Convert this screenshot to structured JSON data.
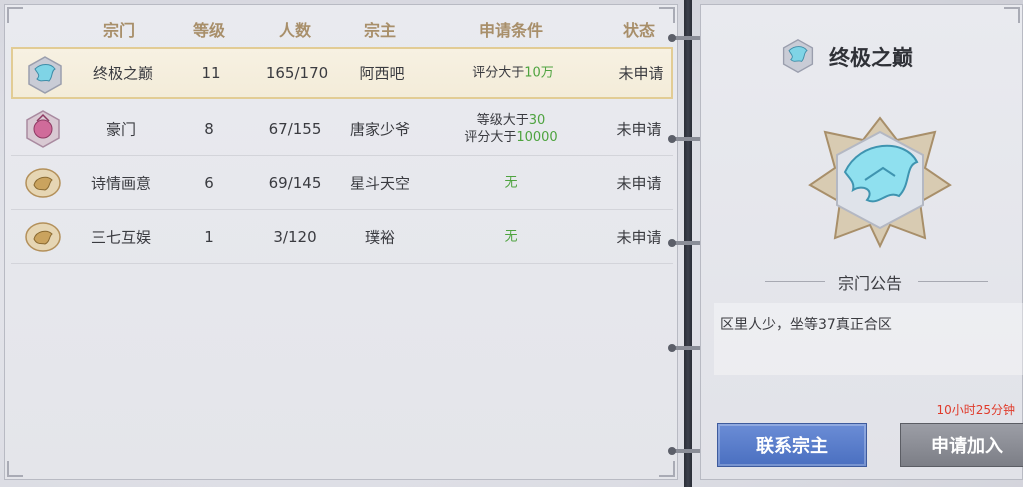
{
  "table": {
    "headers": {
      "sect": "宗门",
      "level": "等级",
      "members": "人数",
      "leader": "宗主",
      "conditions": "申请条件",
      "status": "状态"
    },
    "rows": [
      {
        "name": "终极之巅",
        "level": "11",
        "members": "165/170",
        "leader": "阿西吧",
        "cond_prefix": "评分大于",
        "cond_value": "10万",
        "status": "未申请",
        "emblem": "dragon-emblem-icon",
        "selected": true
      },
      {
        "name": "豪门",
        "level": "8",
        "members": "67/155",
        "leader": "唐家少爷",
        "cond_line1_prefix": "等级大于",
        "cond_line1_value": "30",
        "cond_line2_prefix": "评分大于",
        "cond_line2_value": "10000",
        "status": "未申请",
        "emblem": "pink-crest-emblem-icon"
      },
      {
        "name": "诗情画意",
        "level": "6",
        "members": "69/145",
        "leader": "星斗天空",
        "cond_none": "无",
        "status": "未申请",
        "emblem": "gold-beast-emblem-icon"
      },
      {
        "name": "三七互娱",
        "level": "1",
        "members": "3/120",
        "leader": "璞裕",
        "cond_none": "无",
        "status": "未申请",
        "emblem": "gold-beast-emblem-icon"
      }
    ]
  },
  "detail": {
    "title": "终极之巅",
    "notice_heading": "宗门公告",
    "notice_text": "区里人少，坐等37真正合区",
    "timer": "10小时25分钟",
    "contact_button": "联系宗主",
    "apply_button": "申请加入"
  },
  "colors": {
    "header_text": "#a88f6a",
    "highlight_green": "#4ea33f",
    "timer_red": "#e03a2a",
    "contact_blue": "#4a6fc0",
    "selected_border": "#e2cc94"
  }
}
